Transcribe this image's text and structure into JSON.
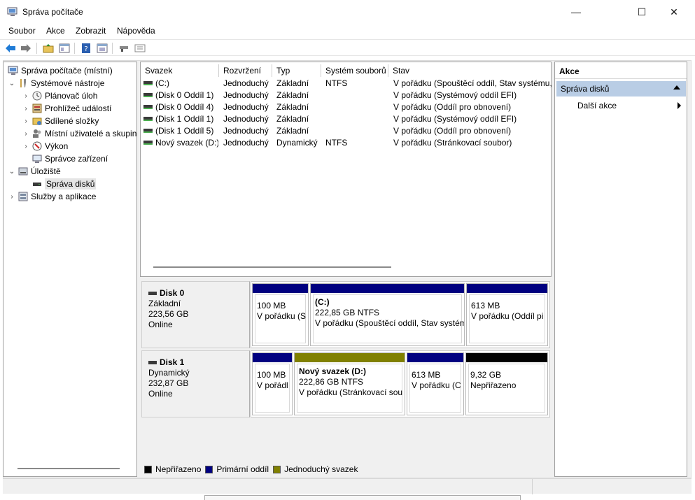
{
  "window": {
    "title": "Správa počítače",
    "controls": {
      "minimize": "—",
      "maximize": "☐",
      "close": "✕"
    }
  },
  "menu": [
    "Soubor",
    "Akce",
    "Zobrazit",
    "Nápověda"
  ],
  "toolbar": {
    "icons": [
      "back-arrow-icon",
      "forward-arrow-icon",
      "up-folder-icon",
      "show-hide-tree-icon",
      "help-icon",
      "properties-icon",
      "connect-icon",
      "list-view-icon"
    ],
    "colors": {
      "nav_arrow": "#1f7bd6"
    }
  },
  "tree": {
    "items": [
      {
        "label": "Správa počítače (místní)",
        "icon": "computer-management-icon",
        "arrow": ""
      },
      {
        "label": "Systémové nástroje",
        "icon": "tools-icon",
        "arrow": "⌄"
      },
      {
        "label": "Plánovač úloh",
        "icon": "clock-icon",
        "arrow": "›"
      },
      {
        "label": "Prohlížeč událostí",
        "icon": "event-viewer-icon",
        "arrow": "›"
      },
      {
        "label": "Sdílené složky",
        "icon": "shared-folder-icon",
        "arrow": "›"
      },
      {
        "label": "Místní uživatelé a skupiny",
        "icon": "users-icon",
        "arrow": "›"
      },
      {
        "label": "Výkon",
        "icon": "performance-icon",
        "arrow": "›"
      },
      {
        "label": "Správce zařízení",
        "icon": "device-manager-icon",
        "arrow": ""
      },
      {
        "label": "Úložiště",
        "icon": "storage-icon",
        "arrow": "⌄"
      },
      {
        "label": "Správa disků",
        "icon": "disk-management-icon",
        "arrow": ""
      },
      {
        "label": "Služby a aplikace",
        "icon": "services-icon",
        "arrow": "›"
      }
    ]
  },
  "volumes": {
    "columns": [
      "Svazek",
      "Rozvržení",
      "Typ",
      "Systém souborů",
      "Stav"
    ],
    "rows": [
      [
        "(C:)",
        "Jednoduchý",
        "Základní",
        "NTFS",
        "V pořádku (Spouštěcí oddíl, Stav systému, Z"
      ],
      [
        "(Disk 0 Oddíl 1)",
        "Jednoduchý",
        "Základní",
        "",
        "V pořádku (Systémový oddíl EFI)"
      ],
      [
        "(Disk 0 Oddíl 4)",
        "Jednoduchý",
        "Základní",
        "",
        "V pořádku (Oddíl pro obnovení)"
      ],
      [
        "(Disk 1 Oddíl 1)",
        "Jednoduchý",
        "Základní",
        "",
        "V pořádku (Systémový oddíl EFI)"
      ],
      [
        "(Disk 1 Oddíl 5)",
        "Jednoduchý",
        "Základní",
        "",
        "V pořádku (Oddíl pro obnovení)"
      ],
      [
        "Nový svazek (D:)",
        "Jednoduchý",
        "Dynamický",
        "NTFS",
        "V pořádku (Stránkovací soubor)"
      ]
    ]
  },
  "disks": [
    {
      "name": "Disk 0",
      "type": "Základní",
      "size": "223,56 GB",
      "status": "Online",
      "partitions": [
        {
          "title": "",
          "line1": "100 MB",
          "line2": "V pořádku (S",
          "kind": "primary"
        },
        {
          "title": "(C:)",
          "line1": "222,85 GB NTFS",
          "line2": "V pořádku (Spouštěcí oddíl, Stav systém",
          "kind": "primary"
        },
        {
          "title": "",
          "line1": "613 MB",
          "line2": "V pořádku (Oddíl pi",
          "kind": "primary"
        }
      ]
    },
    {
      "name": "Disk 1",
      "type": "Dynamický",
      "size": "232,87 GB",
      "status": "Online",
      "partitions": [
        {
          "title": "",
          "line1": "100 MB",
          "line2": "V pořádl",
          "kind": "primary"
        },
        {
          "title": "Nový svazek  (D:)",
          "line1": "222,86 GB NTFS",
          "line2": "V pořádku (Stránkovací sou",
          "kind": "simple"
        },
        {
          "title": "",
          "line1": "613 MB",
          "line2": "V pořádku (C",
          "kind": "primary"
        },
        {
          "title": "",
          "line1": "9,32 GB",
          "line2": "Nepřiřazeno",
          "kind": "unallocated"
        }
      ]
    }
  ],
  "legend": [
    {
      "label": "Nepřiřazeno",
      "color": "#000000"
    },
    {
      "label": "Primární oddíl",
      "color": "#000080"
    },
    {
      "label": "Jednoduchý svazek",
      "color": "#808000"
    }
  ],
  "actions": {
    "header": "Akce",
    "section": "Správa disků",
    "item": "Další akce"
  }
}
